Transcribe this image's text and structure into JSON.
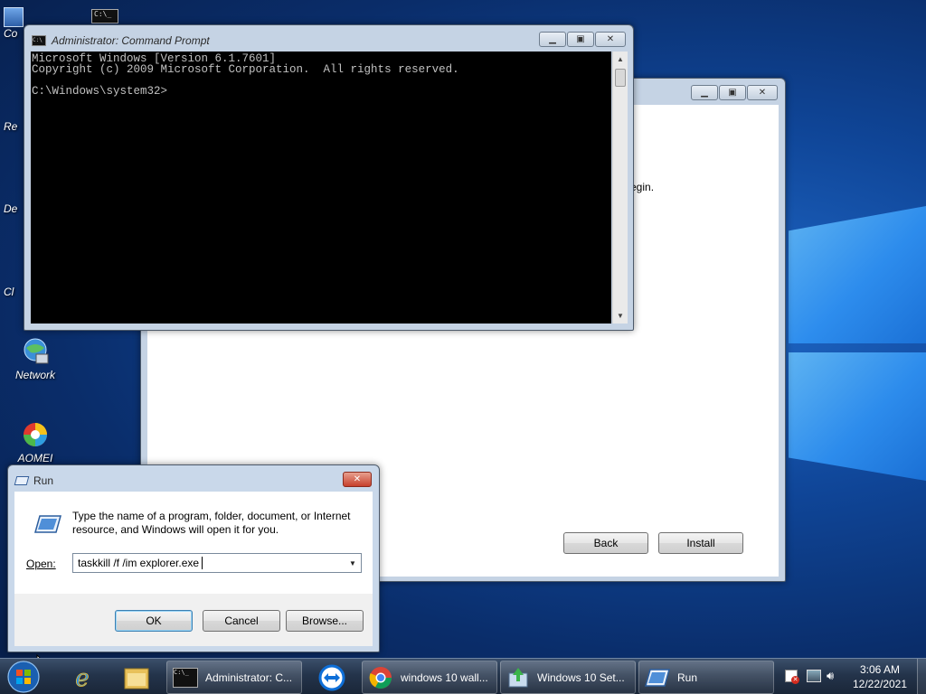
{
  "desktop": {
    "icons": [
      {
        "label": "Co"
      },
      {
        "label": "Re"
      },
      {
        "label": "De"
      },
      {
        "label": "Cl"
      },
      {
        "label": "Network"
      },
      {
        "label": "AOMEI"
      }
    ]
  },
  "cmd": {
    "title": "Administrator: Command Prompt",
    "console_lines": [
      "Microsoft Windows [Version 6.1.7601]",
      "Copyright (c) 2009 Microsoft Corporation.  All rights reserved.",
      "",
      "C:\\Windows\\system32>"
    ]
  },
  "setup": {
    "visible_text_fragment": "egin.",
    "back_label": "Back",
    "install_label": "Install"
  },
  "run": {
    "title": "Run",
    "description": "Type the name of a program, folder, document, or Internet resource, and Windows will open it for you.",
    "open_label": "Open:",
    "input_value": "taskkill /f /im explorer.exe",
    "ok_label": "OK",
    "cancel_label": "Cancel",
    "browse_label": "Browse..."
  },
  "taskbar": {
    "items": [
      {
        "label": "Administrator: C..."
      },
      {
        "label": "windows 10 wall..."
      },
      {
        "label": "Windows 10 Set..."
      },
      {
        "label": "Run"
      }
    ],
    "clock_time": "3:06 AM",
    "clock_date": "12/22/2021"
  },
  "colors": {
    "console_bg": "#000000",
    "console_fg": "#c0c0c0",
    "taskbar": "#24344b"
  }
}
